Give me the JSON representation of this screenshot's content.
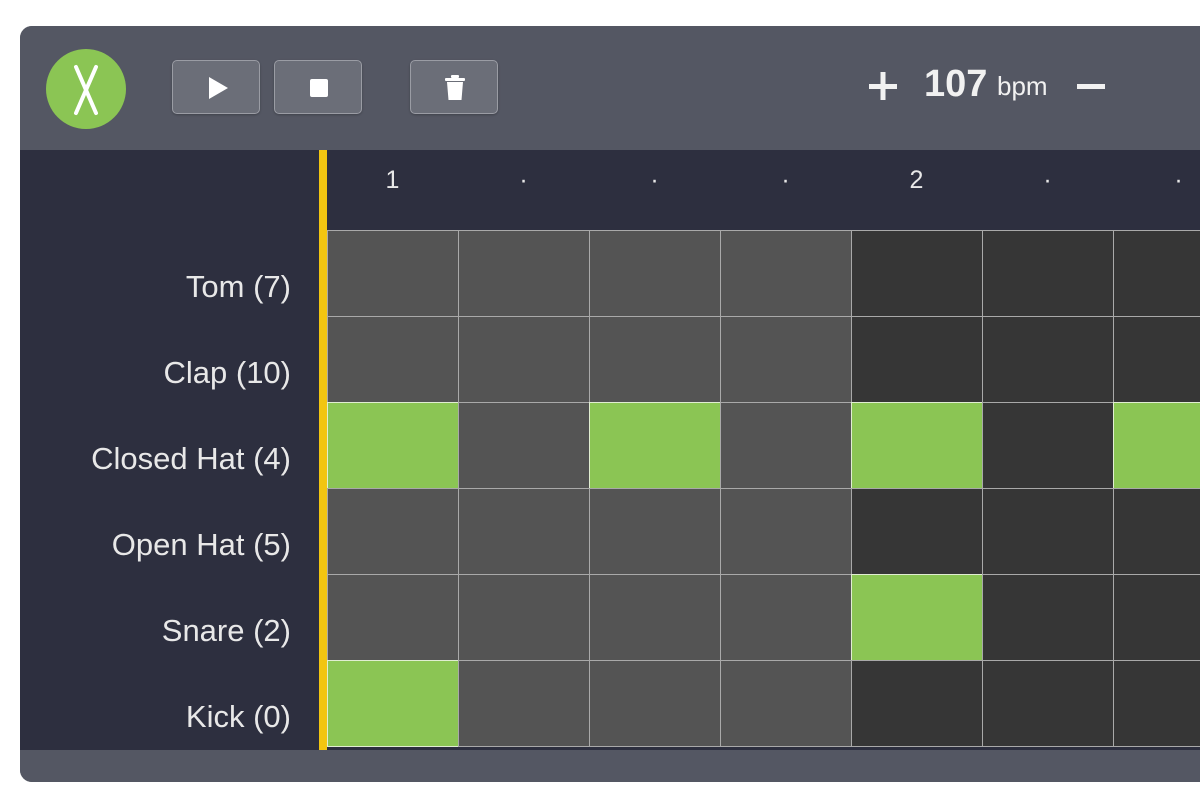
{
  "toolbar": {
    "logo_icon": "crossed-drumsticks-icon",
    "play_icon": "play-icon",
    "stop_icon": "stop-icon",
    "clear_icon": "trash-icon",
    "tempo_increase_label": "+",
    "tempo_value": "107",
    "tempo_unit": "bpm",
    "tempo_decrease_label": "–"
  },
  "colors": {
    "accent_green": "#8bc554",
    "playhead_yellow": "#f2c511",
    "panel": "#545763",
    "background_dark": "#2d2f3f"
  },
  "beat_labels": [
    "1",
    "·",
    "·",
    "·",
    "2",
    "·",
    "·"
  ],
  "rows": [
    {
      "label": "Tom (7)",
      "steps": [
        0,
        0,
        0,
        0,
        0,
        0,
        0
      ]
    },
    {
      "label": "Clap (10)",
      "steps": [
        0,
        0,
        0,
        0,
        0,
        0,
        0
      ]
    },
    {
      "label": "Closed Hat (4)",
      "steps": [
        1,
        0,
        1,
        0,
        1,
        0,
        1
      ]
    },
    {
      "label": "Open Hat (5)",
      "steps": [
        0,
        0,
        0,
        0,
        0,
        0,
        0
      ]
    },
    {
      "label": "Snare (2)",
      "steps": [
        0,
        0,
        0,
        0,
        1,
        0,
        0
      ]
    },
    {
      "label": "Kick (0)",
      "steps": [
        1,
        0,
        0,
        0,
        0,
        0,
        0
      ]
    }
  ]
}
